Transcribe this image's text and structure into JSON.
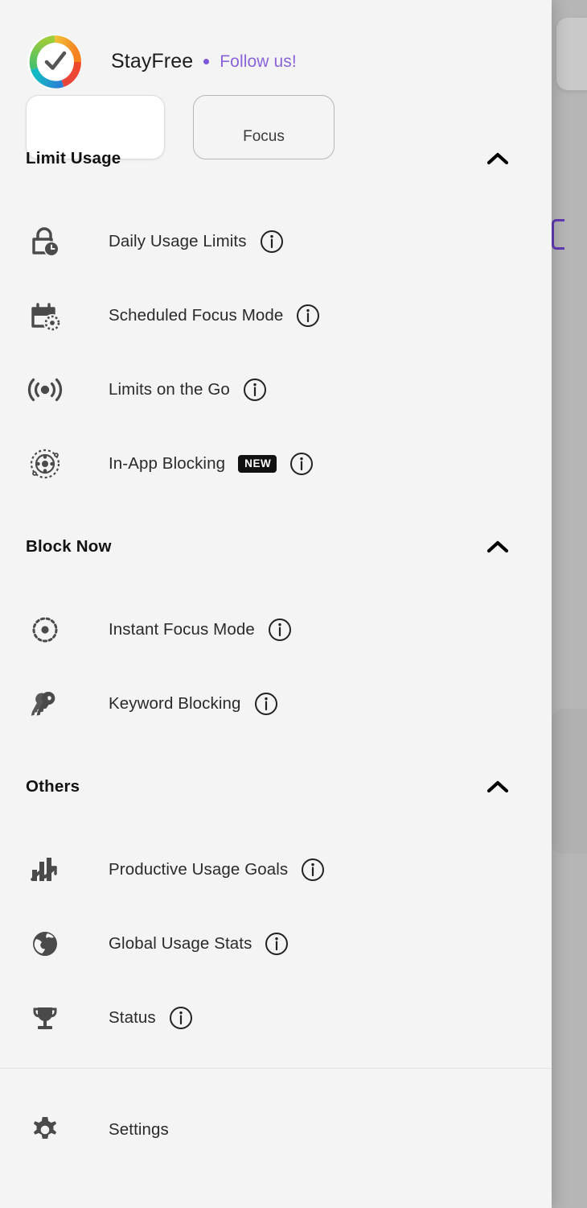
{
  "app": {
    "brand_name": "StayFree",
    "follow_label": "Follow us!",
    "accent_purple": "#8a63d8",
    "drawer_bg": "#f4f4f4",
    "text_color": "#2a2a2a"
  },
  "quick_chips": [
    {
      "label": "",
      "style": "filled"
    },
    {
      "label": "Focus",
      "style": "outlined"
    }
  ],
  "sections": [
    {
      "title": "Limit Usage",
      "collapse_icon": "chevron-up-icon",
      "items": [
        {
          "label": "Daily Usage Limits",
          "icon": "lock-clock-icon",
          "info": true,
          "badge": ""
        },
        {
          "label": "Scheduled Focus Mode",
          "icon": "calendar-focus-icon",
          "info": true,
          "badge": ""
        },
        {
          "label": "Limits on the Go",
          "icon": "broadcast-signal-icon",
          "info": true,
          "badge": ""
        },
        {
          "label": "In-App Blocking",
          "icon": "atom-orbit-icon",
          "info": true,
          "badge": "NEW"
        }
      ]
    },
    {
      "title": "Block Now",
      "collapse_icon": "chevron-up-icon",
      "items": [
        {
          "label": "Instant Focus Mode",
          "icon": "dotted-target-icon",
          "info": true,
          "badge": ""
        },
        {
          "label": "Keyword Blocking",
          "icon": "keys-icon",
          "info": true,
          "badge": ""
        }
      ]
    },
    {
      "title": "Others",
      "collapse_icon": "chevron-up-icon",
      "items": [
        {
          "label": "Productive Usage Goals",
          "icon": "growth-chart-icon",
          "info": true,
          "badge": ""
        },
        {
          "label": "Global Usage Stats",
          "icon": "globe-icon",
          "info": true,
          "badge": ""
        },
        {
          "label": "Status",
          "icon": "trophy-icon",
          "info": true,
          "badge": ""
        }
      ]
    }
  ],
  "footer": {
    "settings_label": "Settings",
    "settings_icon": "gear-icon"
  }
}
